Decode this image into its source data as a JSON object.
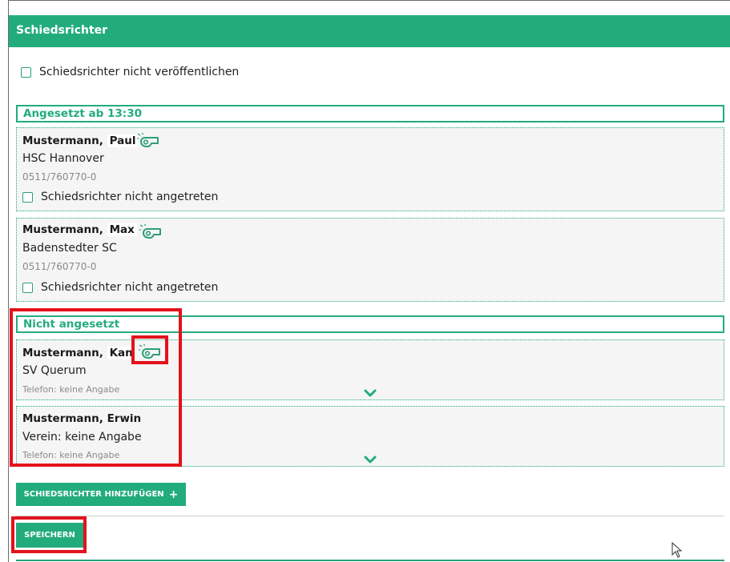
{
  "header": {
    "title": "Schiedsrichter"
  },
  "top_option": {
    "label": "Schiedsrichter nicht veröffentlichen"
  },
  "sections": [
    {
      "title": "Angesetzt ab 13:30",
      "referees": [
        {
          "last_name": "Mustermann,",
          "first_name": "Paul",
          "club": "HSC Hannover",
          "phone": "0511/760770-0",
          "no_show_label": "Schiedsrichter nicht angetreten"
        },
        {
          "last_name": "Mustermann,",
          "first_name": "Max",
          "club": "Badenstedter SC",
          "phone": "0511/760770-0",
          "no_show_label": "Schiedsrichter nicht angetreten"
        }
      ]
    },
    {
      "title": "Nicht angesetzt",
      "referees": [
        {
          "last_name": "Mustermann,",
          "first_name": "Kan",
          "club": "SV Querum",
          "phone": "Telefon: keine Angabe"
        },
        {
          "name": "Mustermann, Erwin",
          "club": "Verein: keine Angabe",
          "phone": "Telefon: keine Angabe"
        }
      ]
    }
  ],
  "buttons": {
    "add_label": "SCHIEDSRICHTER HINZUFÜGEN",
    "add_icon": "+",
    "save_label": "SPEICHERN"
  },
  "icons": {
    "whistle": "whistle-icon",
    "expand": "chevron-down-icon",
    "cursor": "mouse-cursor-icon"
  },
  "colors": {
    "accent": "#22ac7c",
    "highlight": "#e3121b",
    "card_bg": "#f5f5f5"
  }
}
